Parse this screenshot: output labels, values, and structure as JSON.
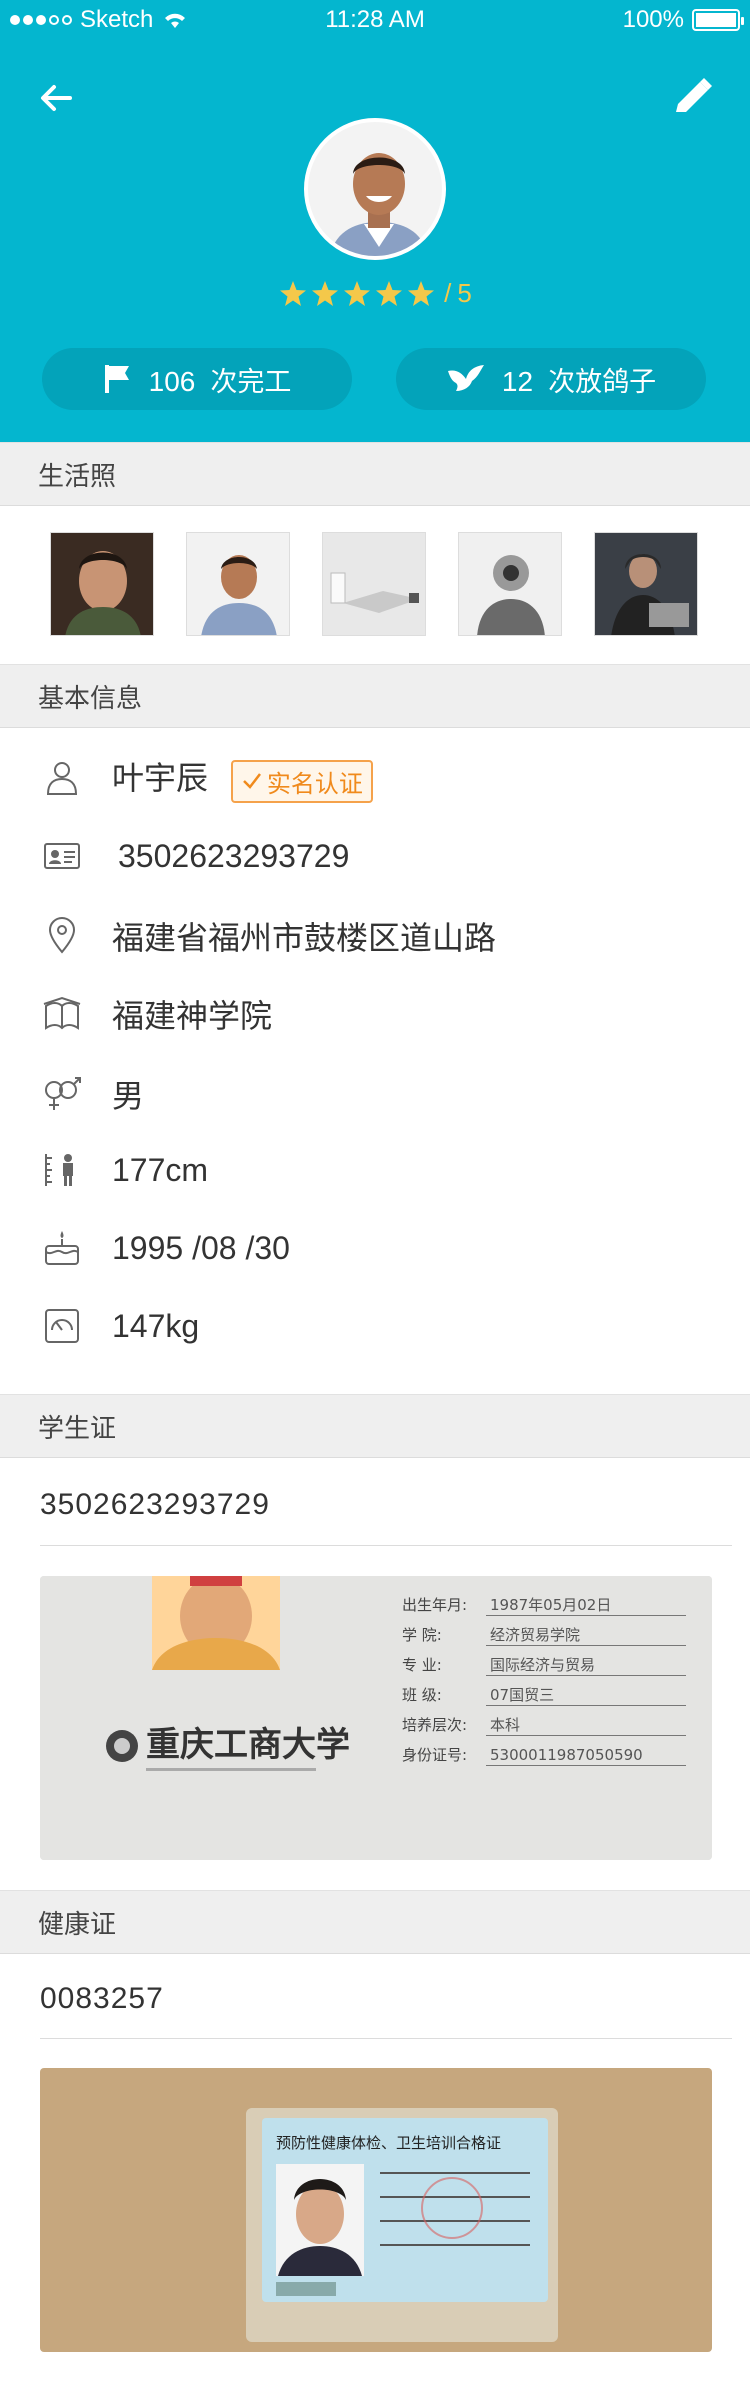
{
  "status_bar": {
    "carrier": "Sketch",
    "time": "11:28 AM",
    "battery": "100%"
  },
  "header": {
    "back_icon": "back-arrow-icon",
    "edit_icon": "pencil-icon",
    "rating": {
      "stars": 5,
      "max_label": "5",
      "separator": "/"
    },
    "stats": [
      {
        "icon": "flag-icon",
        "count": "106",
        "label": "次完工"
      },
      {
        "icon": "bird-icon",
        "count": "12",
        "label": "次放鸽子"
      }
    ],
    "colors": {
      "primary": "#04b6cf",
      "pill": "#03a3ba",
      "star": "#f4c84a",
      "badge": "#f08a1c"
    }
  },
  "life_photos": {
    "title": "生活照",
    "count": 5
  },
  "basic_info": {
    "title": "基本信息",
    "name": "叶宇辰",
    "verified_badge": "实名认证",
    "id_number": "3502623293729",
    "address": "福建省福州市鼓楼区道山路",
    "school": "福建神学院",
    "gender": "男",
    "height": "177cm",
    "birthday": "1995 /08 /30",
    "weight": "147kg"
  },
  "student_card": {
    "title": "学生证",
    "number": "3502623293729",
    "card_text": {
      "school_name": "重庆工商大学",
      "fields": [
        "出生年月:",
        "学    院:",
        "专    业:",
        "班    级:",
        "培养层次:",
        "身份证号:"
      ],
      "values": [
        "1987年05月02日",
        "经济贸易学院",
        "国际经济与贸易",
        "07国贸三",
        "本科",
        "5300011987050590"
      ]
    }
  },
  "health_card": {
    "title": "健康证",
    "number": "0083257",
    "card_text": {
      "header": "预防性健康体检、卫生培训合格证"
    }
  }
}
